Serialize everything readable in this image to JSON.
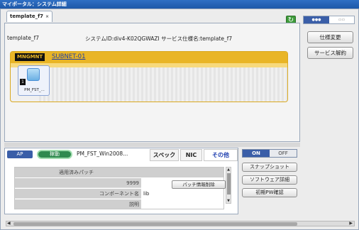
{
  "window": {
    "title": "マイポータル：システム詳細",
    "close_label": "×"
  },
  "tab": {
    "label": "template_f7",
    "close_label": "×"
  },
  "toolbar": {
    "refresh_glyph": "↻"
  },
  "view_toggle": {
    "left_label": "●●●",
    "right_label": "▭▭"
  },
  "system_info": {
    "template_name": "template_f7",
    "system_line": "システムID:div4-K02QGWAZI  サービス仕様名:template_f7"
  },
  "network": {
    "tag": "MNGMNT",
    "subnet_name": "SUBNET-01",
    "accent_color": "#e9b526"
  },
  "server": {
    "index": "1",
    "label": "PM_FST_..."
  },
  "side_buttons": {
    "spec_change": "仕様変更",
    "service_cancel": "サービス解約"
  },
  "detail": {
    "ap_label": "AP",
    "status_label": "稼動",
    "server_name": "PM_FST_Win2008...",
    "tabs": {
      "spec": "スペック",
      "nic": "NIC",
      "other": "その他"
    },
    "rows": [
      {
        "label": "適用済みパッチ",
        "value": ""
      },
      {
        "label": "9999",
        "value": ""
      },
      {
        "label": "コンポーネント名",
        "value": "lib"
      },
      {
        "label": "説明",
        "value": ""
      }
    ],
    "patch_delete_button": "パッチ情報削除"
  },
  "power": {
    "on_label": "ON",
    "off_label": "OFF",
    "state": "ON"
  },
  "actions": {
    "snapshot": "スナップショット",
    "software_detail": "ソフトウェア詳細",
    "initial_pw": "初期PW確認"
  },
  "scrollbar": {
    "left_arrow": "◀",
    "right_arrow": "▶",
    "grip": "≡",
    "up_arrow": "▲",
    "down_arrow": "▼"
  }
}
